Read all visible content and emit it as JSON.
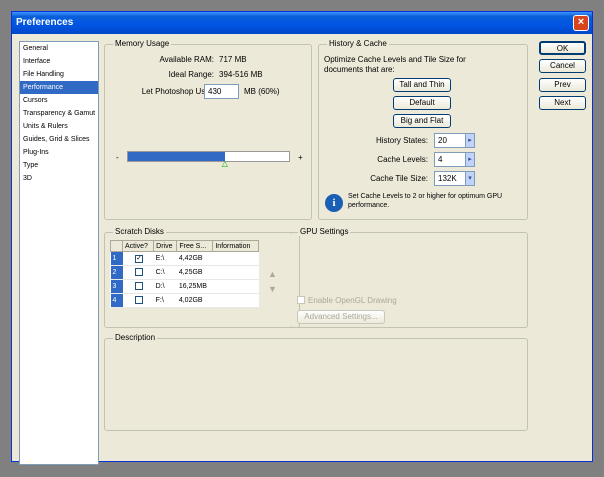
{
  "window": {
    "title": "Preferences",
    "close_label": "×"
  },
  "nav": {
    "items": [
      {
        "label": "General"
      },
      {
        "label": "Interface"
      },
      {
        "label": "File Handling"
      },
      {
        "label": "Performance",
        "selected": true
      },
      {
        "label": "Cursors"
      },
      {
        "label": "Transparency & Gamut"
      },
      {
        "label": "Units & Rulers"
      },
      {
        "label": "Guides, Grid & Slices"
      },
      {
        "label": "Plug-Ins"
      },
      {
        "label": "Type"
      },
      {
        "label": "3D"
      }
    ]
  },
  "memory": {
    "title": "Memory Usage",
    "available_label": "Available RAM:",
    "available_value": "717 MB",
    "ideal_label": "Ideal Range:",
    "ideal_value": "394-516 MB",
    "use_label": "Let Photoshop Use:",
    "use_value": "430",
    "use_unit": "MB (60%)",
    "slider_min": "-",
    "slider_max": "+",
    "slider_fraction": 0.6
  },
  "history": {
    "title": "History & Cache",
    "optimize_text": "Optimize Cache Levels and Tile Size for documents that are:",
    "btn_tall": "Tall and Thin",
    "btn_default": "Default",
    "btn_big": "Big and Flat",
    "states_label": "History States:",
    "states_value": "20",
    "levels_label": "Cache Levels:",
    "levels_value": "4",
    "tile_label": "Cache Tile Size:",
    "tile_value": "132K",
    "info_text": "Set Cache Levels to 2 or higher for optimum GPU performance."
  },
  "scratch": {
    "title": "Scratch Disks",
    "columns": [
      "Active?",
      "Drive",
      "Free S...",
      "Information"
    ],
    "rows": [
      {
        "idx": "1",
        "active": true,
        "drive": "E:\\",
        "free": "4,42GB",
        "info": ""
      },
      {
        "idx": "2",
        "active": false,
        "drive": "C:\\",
        "free": "4,25GB",
        "info": ""
      },
      {
        "idx": "3",
        "active": false,
        "drive": "D:\\",
        "free": "16,25MB",
        "info": ""
      },
      {
        "idx": "4",
        "active": false,
        "drive": "F:\\",
        "free": "4,02GB",
        "info": ""
      }
    ]
  },
  "gpu": {
    "title": "GPU Settings",
    "opengl_label": "Enable OpenGL Drawing",
    "advanced_label": "Advanced Settings..."
  },
  "description": {
    "title": "Description"
  },
  "actions": {
    "ok": "OK",
    "cancel": "Cancel",
    "prev": "Prev",
    "next": "Next"
  }
}
